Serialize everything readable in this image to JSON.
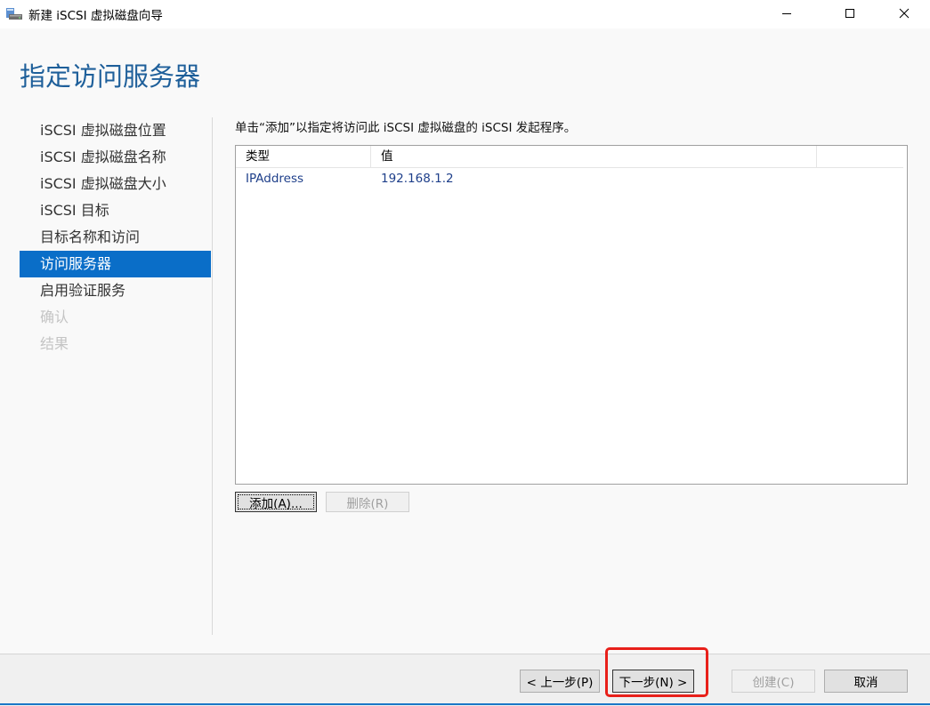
{
  "window": {
    "title": "新建 iSCSI 虚拟磁盘向导",
    "app_icon": "iscsi-disk-icon",
    "controls": [
      "minimize-icon",
      "maximize-icon",
      "close-icon"
    ]
  },
  "page_title": "指定访问服务器",
  "nav": {
    "items": [
      {
        "label": "iSCSI 虚拟磁盘位置",
        "state": "normal"
      },
      {
        "label": "iSCSI 虚拟磁盘名称",
        "state": "normal"
      },
      {
        "label": "iSCSI 虚拟磁盘大小",
        "state": "normal"
      },
      {
        "label": "iSCSI 目标",
        "state": "normal"
      },
      {
        "label": "目标名称和访问",
        "state": "normal"
      },
      {
        "label": "访问服务器",
        "state": "active"
      },
      {
        "label": "启用验证服务",
        "state": "normal"
      },
      {
        "label": "确认",
        "state": "disabled"
      },
      {
        "label": "结果",
        "state": "disabled"
      }
    ]
  },
  "main": {
    "instruction": "单击“添加”以指定将访问此 iSCSI 虚拟磁盘的 iSCSI 发起程序。",
    "table": {
      "columns": [
        "类型",
        "值",
        ""
      ],
      "rows": [
        {
          "type": "IPAddress",
          "value": "192.168.1.2"
        }
      ]
    },
    "add_button": "添加(A)...",
    "remove_button": "删除(R)"
  },
  "footer": {
    "back_button": "< 上一步(P)",
    "next_button": "下一步(N) >",
    "create_button": "创建(C)",
    "cancel_button": "取消"
  },
  "colors": {
    "accent": "#0a6ec8",
    "title": "#1e5f9a",
    "highlight": "#e8201a"
  }
}
